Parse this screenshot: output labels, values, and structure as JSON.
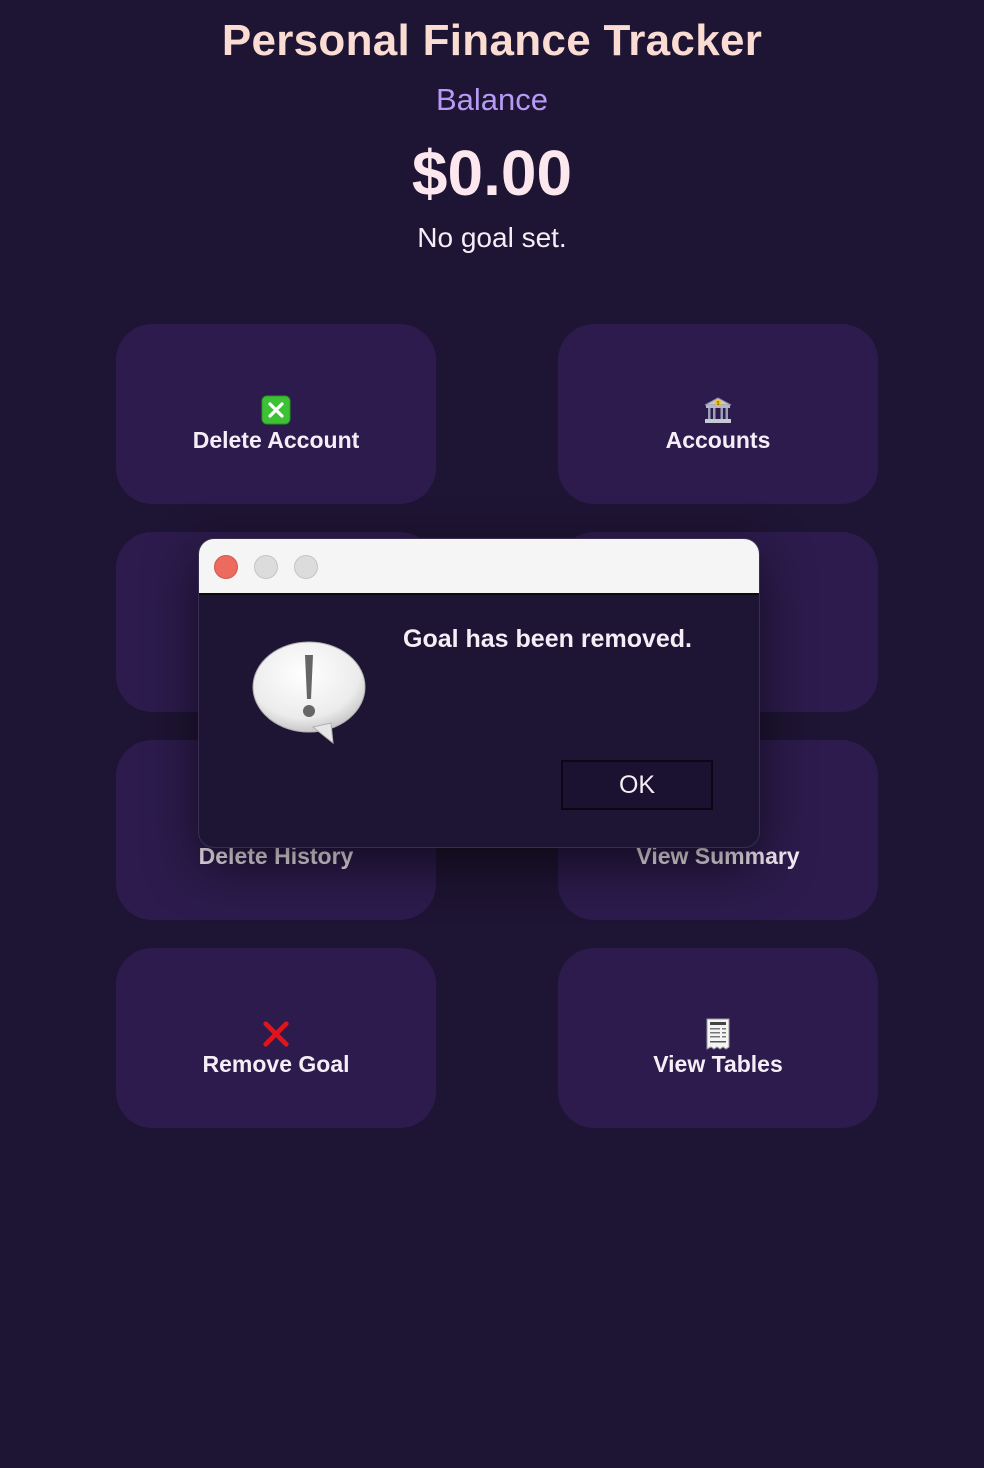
{
  "header": {
    "title": "Personal Finance Tracker",
    "balance_label": "Balance",
    "balance_amount": "$0.00",
    "goal_status": "No goal set."
  },
  "tiles": [
    {
      "label": "Delete Account",
      "icon": "cross-mark-button-icon"
    },
    {
      "label": "Accounts",
      "icon": "bank-icon"
    },
    {
      "label": "",
      "icon": ""
    },
    {
      "label": "",
      "icon": ""
    },
    {
      "label": "Delete History",
      "icon": ""
    },
    {
      "label": "View Summary",
      "icon": ""
    },
    {
      "label": "Remove Goal",
      "icon": "cross-mark-icon"
    },
    {
      "label": "View Tables",
      "icon": "receipt-icon"
    }
  ],
  "dialog": {
    "message": "Goal has been removed.",
    "ok_label": "OK",
    "icon": "alert-speech-bubble-icon"
  },
  "colors": {
    "background": "#1e1433",
    "tile": "#2c1b4c",
    "title": "#fbdcd3",
    "balance_label": "#b69af5",
    "close_button": "#ec6a5e"
  }
}
